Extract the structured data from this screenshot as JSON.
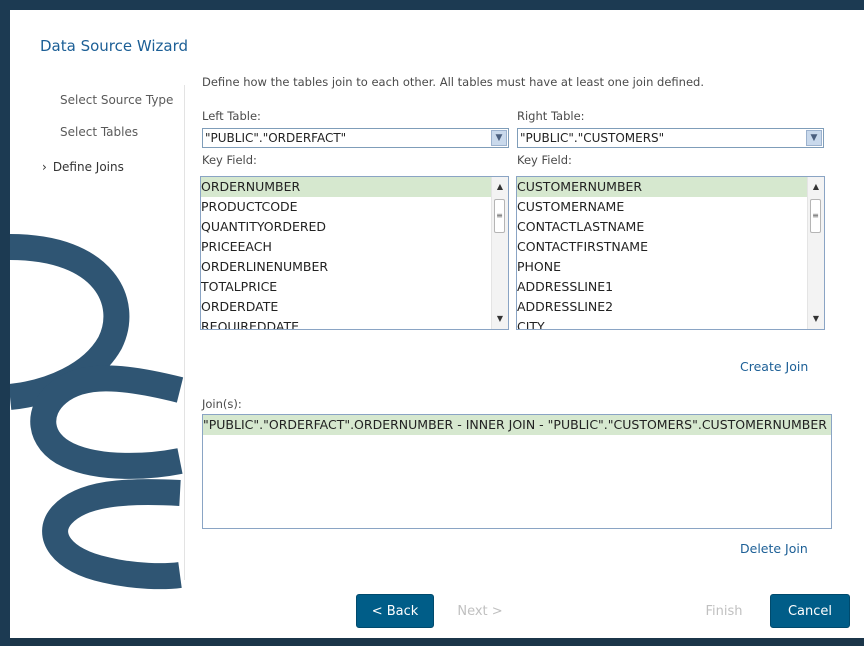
{
  "dialog": {
    "title": "Data Source Wizard"
  },
  "steps": [
    {
      "label": "Select Source Type"
    },
    {
      "label": "Select Tables"
    },
    {
      "label": "Define Joins",
      "marker": "›"
    }
  ],
  "instruction": "Define how the tables join to each other. All tables must have at least one join defined.",
  "left": {
    "table_label": "Left Table:",
    "table_value": "\"PUBLIC\".\"ORDERFACT\"",
    "key_label": "Key Field:",
    "fields": [
      "ORDERNUMBER",
      "PRODUCTCODE",
      "QUANTITYORDERED",
      "PRICEEACH",
      "ORDERLINENUMBER",
      "TOTALPRICE",
      "ORDERDATE",
      "REQUIREDDATE"
    ],
    "selected_index": 0
  },
  "right": {
    "table_label": "Right Table:",
    "table_value": "\"PUBLIC\".\"CUSTOMERS\"",
    "key_label": "Key Field:",
    "fields": [
      "CUSTOMERNUMBER",
      "CUSTOMERNAME",
      "CONTACTLASTNAME",
      "CONTACTFIRSTNAME",
      "PHONE",
      "ADDRESSLINE1",
      "ADDRESSLINE2",
      "CITY"
    ],
    "selected_index": 0
  },
  "create_join": "Create Join",
  "joins_label": "Join(s):",
  "joins": [
    "\"PUBLIC\".\"ORDERFACT\".ORDERNUMBER - INNER JOIN - \"PUBLIC\".\"CUSTOMERS\".CUSTOMERNUMBER"
  ],
  "delete_join": "Delete Join",
  "buttons": {
    "back": "< Back",
    "next": "Next >",
    "finish": "Finish",
    "cancel": "Cancel"
  },
  "icons": {
    "dropdown": "chevron-down-icon",
    "scroll_up": "scroll-up-icon",
    "scroll_down": "scroll-down-icon",
    "step_marker": "chevron-right-icon"
  },
  "colors": {
    "accent": "#005d88",
    "link": "#1c5f96",
    "selection": "#d6e8cf",
    "frame": "#1c3a52",
    "logo": "#2f5573"
  }
}
